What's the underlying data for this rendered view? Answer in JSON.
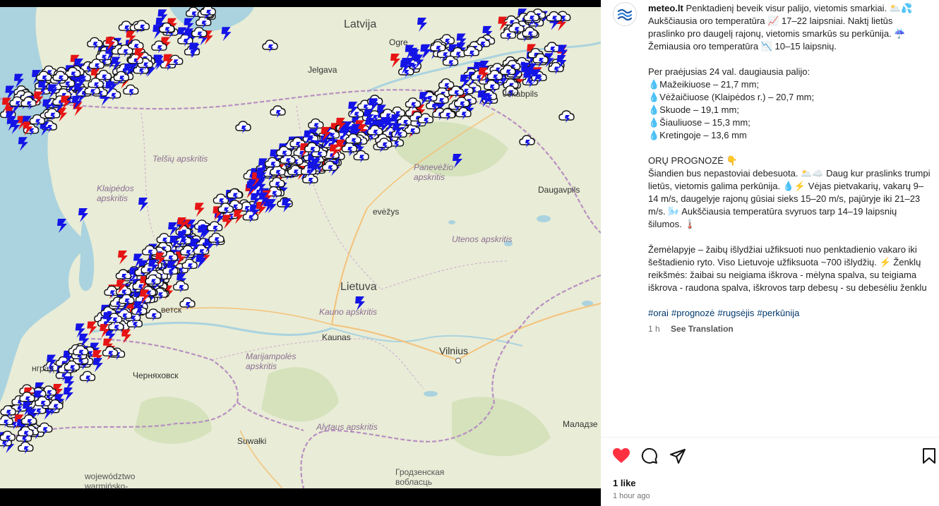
{
  "map": {
    "places": [
      {
        "id": "latvija",
        "text": "Latvija",
        "kind": "country"
      },
      {
        "id": "ogre",
        "text": "Ogre",
        "kind": "small"
      },
      {
        "id": "jelgava",
        "text": "Jelgava",
        "kind": "small"
      },
      {
        "id": "jekabpils",
        "text": "Jēkabpils",
        "kind": "small"
      },
      {
        "id": "telsiu",
        "text": "Telšių apskritis",
        "kind": "region"
      },
      {
        "id": "panevezio",
        "text": "Panevėžio\napskritis",
        "kind": "region"
      },
      {
        "id": "klaipedos",
        "text": "Klaipėdos\napskritis",
        "kind": "region"
      },
      {
        "id": "panevezys",
        "text": "evėžys",
        "kind": "small"
      },
      {
        "id": "daugavpils",
        "text": "Daugavpils",
        "kind": "small"
      },
      {
        "id": "utenos",
        "text": "Utenos apskritis",
        "kind": "region"
      },
      {
        "id": "lietuva",
        "text": "Lietuva",
        "kind": "country"
      },
      {
        "id": "kauno",
        "text": "Kauno apskritis",
        "kind": "region"
      },
      {
        "id": "kaunas",
        "text": "Kaunas",
        "kind": "small"
      },
      {
        "id": "vilnius",
        "text": "Vilnius",
        "kind": "normal"
      },
      {
        "id": "marijampoles",
        "text": "Marijampolės\napskritis",
        "kind": "region"
      },
      {
        "id": "chernyakhovsk",
        "text": "Черняховск",
        "kind": "small"
      },
      {
        "id": "sovetsk",
        "text": "ветск",
        "kind": "small"
      },
      {
        "id": "kaliningrad",
        "text": "нград",
        "kind": "small"
      },
      {
        "id": "suwalki",
        "text": "Suwałki",
        "kind": "small"
      },
      {
        "id": "alytaus",
        "text": "Alytaus apskritis",
        "kind": "region"
      },
      {
        "id": "molodechno",
        "text": "Маладзе",
        "kind": "small"
      },
      {
        "id": "grodno",
        "text": "Гродзенская\nвобласць",
        "kind": "rural"
      },
      {
        "id": "warminsko",
        "text": "województwo\nwarmińsko-",
        "kind": "rural"
      }
    ]
  },
  "post": {
    "username": "meteo.lt",
    "caption_intro": "Penktadienį beveik visur palijo, vietomis smarkiai. 🌥️💦 Aukščiausia oro temperatūra 📈 17–22 laipsniai. Naktį lietūs praslinko pro daugelį rajonų, vietomis smarkūs su perkūnija. ☔ Žemiausia oro temperatūra 📉 10–15 laipsnių.",
    "rain_title": "Per praėjusias 24 val. daugiausia palijo:",
    "rain_list": [
      "💧Mažeikiuose – 21,7 mm;",
      "💧Vėžaičiuose (Klaipėdos r.) – 20,7 mm;",
      "💧Skuode – 19,1 mm;",
      "💧Šiauliuose – 15,3 mm;",
      "💧Kretingoje – 13,6 mm"
    ],
    "forecast_title": "ORŲ PROGNOZĖ 👇",
    "forecast_text": "Šiandien bus nepastoviai debesuota. 🌥️☁️ Daug kur praslinks trumpi lietūs, vietomis galima perkūnija. 💧⚡ Vėjas pietvakarių, vakarų 9–14 m/s, daugelyje rajonų gūsiai sieks 15–20 m/s, pajūryje iki 21–23 m/s. 🌬️ Aukščiausia temperatūra svyruos tarp 14–19 laipsnių šilumos. 🌡️",
    "map_note": "Žemėlapyje – žaibų išlydžiai užfiksuoti nuo penktadienio vakaro iki šeštadienio ryto. Viso Lietuvoje užfiksuota ~700 išlydžių. ⚡ Ženklų reikšmės: žaibai su neigiama iškrova - mėlyna spalva, su teigiama iškrova - raudona spalva, iškrovos tarp debesų - su debesėliu ženklu",
    "hashtags": [
      "#orai",
      "#prognozė",
      "#rugsėjis",
      "#perkūnija"
    ],
    "time_ago": "1 h",
    "see_translation": "See Translation",
    "likes": "1 like",
    "posted_ago": "1 hour ago"
  },
  "colors": {
    "negative_strike": "#1414e6",
    "positive_strike": "#e61414",
    "sea": "#aad3df",
    "land": "#e9ecd6",
    "like_red": "#ff3040"
  },
  "icons": {
    "avatar": "meteo-logo-icon",
    "like": "heart-icon",
    "comment": "comment-icon",
    "share": "send-icon",
    "save": "bookmark-icon"
  }
}
